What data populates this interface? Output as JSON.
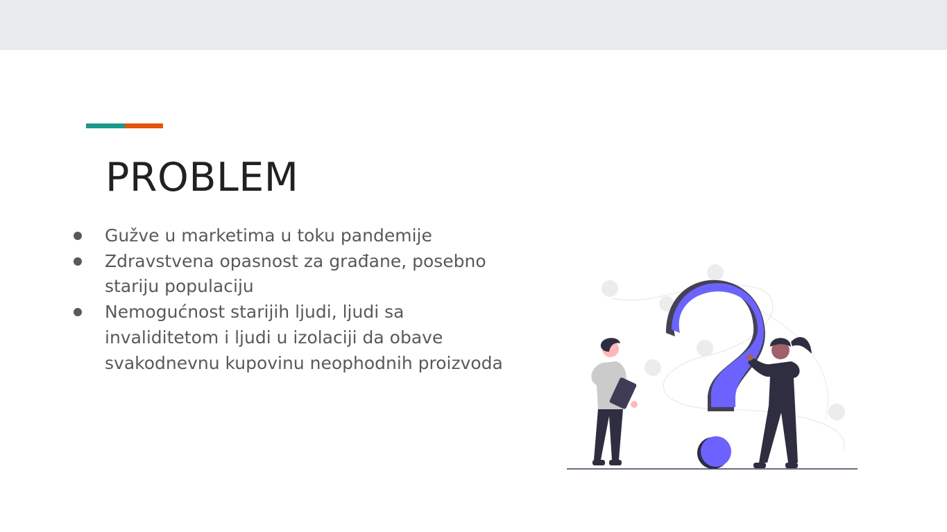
{
  "colors": {
    "topbar": "#e8ebec",
    "accent_teal": "#1a998b",
    "accent_orange": "#e2550c",
    "title_text": "#212121",
    "body_text": "#595959",
    "illustration_purple": "#6c63ff",
    "illustration_dark": "#2f2e41"
  },
  "slide": {
    "title": "PROBLEM",
    "bullets": [
      "Gužve u marketima u toku pandemije",
      "Zdravstvena opasnost za građane, posebno stariju populaciju",
      "Nemogućnost starijih ljudi, ljudi sa invaliditetom i ljudi u izolaciji da obave svakodnevnu kupovinu neophodnih proizvoda"
    ],
    "illustration_icon": "question-mark-people-illustration"
  }
}
